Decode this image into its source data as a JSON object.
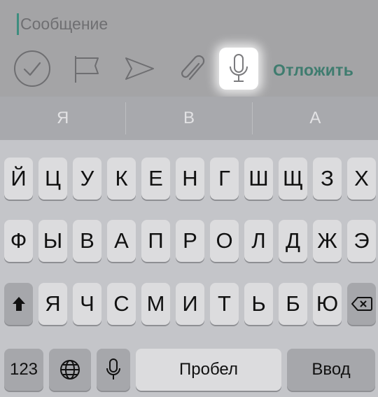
{
  "compose": {
    "placeholder": "Сообщение",
    "postpone_label": "Отложить"
  },
  "icons": {
    "check": "check-circle-icon",
    "flag": "flag-icon",
    "send": "send-icon",
    "attach": "paperclip-icon",
    "mic": "microphone-icon"
  },
  "suggestions": [
    "Я",
    "В",
    "А"
  ],
  "keyboard": {
    "row1": [
      "Й",
      "Ц",
      "У",
      "К",
      "Е",
      "Н",
      "Г",
      "Ш",
      "Щ",
      "З",
      "Х"
    ],
    "row2": [
      "Ф",
      "Ы",
      "В",
      "А",
      "П",
      "Р",
      "О",
      "Л",
      "Д",
      "Ж",
      "Э"
    ],
    "row3": [
      "Я",
      "Ч",
      "С",
      "М",
      "И",
      "Т",
      "Ь",
      "Б",
      "Ю"
    ],
    "numbers_label": "123",
    "space_label": "Пробел",
    "enter_label": "Ввод"
  },
  "colors": {
    "accent": "#3f7c6f",
    "caret": "#3d8d7f"
  }
}
